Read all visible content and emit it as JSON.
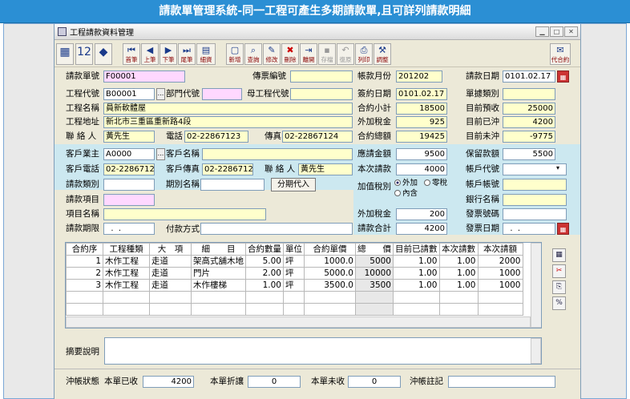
{
  "banner": {
    "title": "請款單管理系統-同一工程可產生多期請款單,且可詳列請款明細"
  },
  "window": {
    "title": "工程請款資料管理"
  },
  "toolbar": {
    "buttons": [
      "首筆",
      "上筆",
      "下筆",
      "尾筆",
      "細資料",
      "新增",
      "查詢",
      "修改",
      "刪除",
      "離開",
      "存檔",
      "復原",
      "列印",
      "調整",
      "代合約"
    ]
  },
  "form": {
    "order_no_label": "請款單號",
    "order_no": "F00001",
    "invoice_no_label": "傳票編號",
    "invoice_no": "",
    "period_label": "帳款月份",
    "period": "201202",
    "req_date_label": "請款日期",
    "req_date": "0101.02.17",
    "proj_code_label": "工程代號",
    "proj_code": "B00001",
    "dept_label": "部門代號",
    "dept": "",
    "parent_label": "母工程代號",
    "parent": "",
    "sign_date_label": "簽約日期",
    "sign_date": "0101.02.17",
    "doc_type_label": "單據類別",
    "doc_type": "",
    "proj_name_label": "工程名稱",
    "proj_name": "員新軟體屋",
    "contract_sub_label": "合約小計",
    "contract_sub": "18500",
    "prepaid_label": "目前預收",
    "prepaid": "25000",
    "proj_addr_label": "工程地址",
    "proj_addr": "新北市三重區重新路4段",
    "ext_tax_label": "外加稅金",
    "ext_tax": "925",
    "offset_label": "目前已沖",
    "offset": "4200",
    "contact_label": "聯 絡 人",
    "contact": "黃先生",
    "phone_label": "電話",
    "phone": "02-22867123",
    "fax_label": "傳真",
    "fax": "02-22867124",
    "contract_total_label": "合約總額",
    "contract_total": "19425",
    "unoffset_label": "目前未沖",
    "unoffset": "-9775",
    "cust_code_label": "客戶業主",
    "cust_code": "A0000",
    "cust_name_label": "客戶名稱",
    "cust_name": "",
    "req_amt_label": "應請金額",
    "req_amt": "9500",
    "retain_label": "保留款額",
    "retain": "5500",
    "cust_phone_label": "客戶電話",
    "cust_phone": "02-22867123",
    "cust_fax_label": "客戶傳真",
    "cust_fax": "02-22867124",
    "cust_contact_label": "聯 絡 人",
    "cust_contact": "黃先生",
    "this_req_label": "本次請款",
    "this_req": "4000",
    "acct_code_label": "帳戶代號",
    "acct_code": "",
    "req_cat_label": "請款類別",
    "req_cat": "",
    "period_name_label": "期別名稱",
    "period_name": "",
    "split_btn": "分期代入",
    "tax_type_label": "加值稅別",
    "tax_opt1": "外加",
    "tax_opt2": "零稅",
    "tax_opt3": "內含",
    "acct_no_label": "帳戶帳號",
    "acct_no": "",
    "req_item_label": "請款項目",
    "req_item": "",
    "bank_label": "銀行名稱",
    "bank": "",
    "item_name_label": "項目名稱",
    "item_name": "",
    "ext_tax2_label": "外加稅金",
    "ext_tax2": "200",
    "ticket_no_label": "發票號碼",
    "ticket_no": "",
    "req_term_label": "請款期限",
    "req_term": "  .  .",
    "pay_method_label": "付款方式",
    "pay_method": "",
    "req_total_label": "請款合計",
    "req_total": "4200",
    "ticket_date_label": "發票日期",
    "ticket_date": "  .  ."
  },
  "grid": {
    "headers": [
      "合約序",
      "工程種類",
      "大　項",
      "細　　目",
      "合約數量",
      "單位",
      "合約單價",
      "總　　價",
      "目前已請數",
      "本次請數",
      "本次請額"
    ],
    "rows": [
      [
        "1",
        "木作工程",
        "走道",
        "架高式舖木地",
        "5.00",
        "坪",
        "1000.0",
        "5000",
        "1.00",
        "1.00",
        "2000"
      ],
      [
        "2",
        "木作工程",
        "走道",
        "門片",
        "2.00",
        "坪",
        "5000.0",
        "10000",
        "1.00",
        "1.00",
        "1000"
      ],
      [
        "3",
        "木作工程",
        "走道",
        "木作樓梯",
        "1.00",
        "坪",
        "3500.0",
        "3500",
        "1.00",
        "1.00",
        "1000"
      ]
    ]
  },
  "note": {
    "label": "摘要說明",
    "value": ""
  },
  "footer": {
    "status_label": "沖帳狀態",
    "received_label": "本單已收",
    "received": "4200",
    "discount_label": "本單折讓",
    "discount": "0",
    "unreceived_label": "本單未收",
    "unreceived": "0",
    "remark_label": "沖帳註記",
    "remark": ""
  }
}
